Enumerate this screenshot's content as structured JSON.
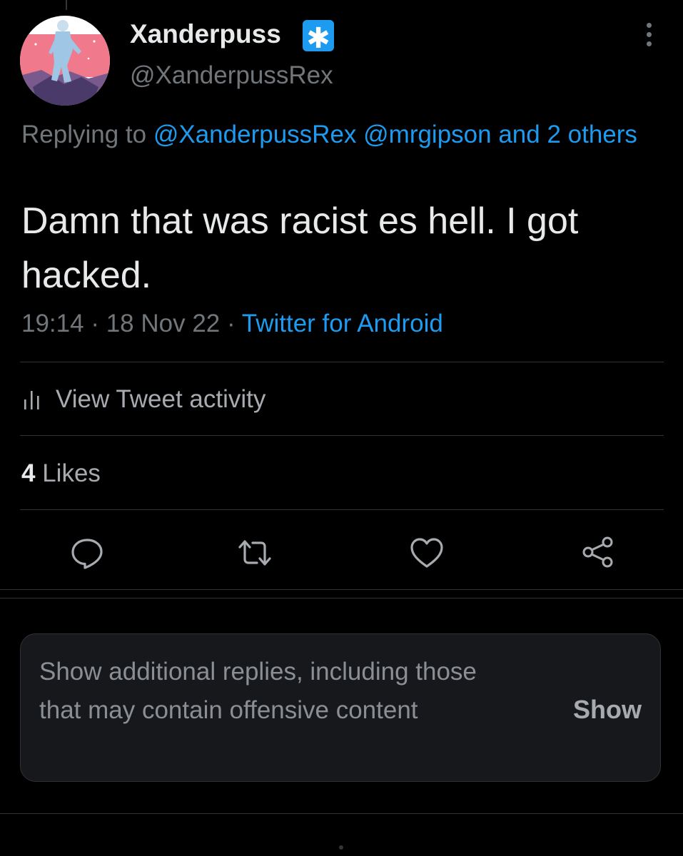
{
  "tweet": {
    "display_name": "Xanderpuss",
    "handle": "@XanderpussRex",
    "label_glyph": "✱",
    "replying_prefix": "Replying to",
    "replying_mentions": "@XanderpussRex @mrgipson and 2 others",
    "text": "Damn that was racist es hell. I got hacked.",
    "time": "19:14",
    "date": "18 Nov 22",
    "source": "Twitter for Android",
    "separator": "·"
  },
  "activity": {
    "label": "View Tweet activity",
    "icon": "bar-chart-icon"
  },
  "likes": {
    "count": "4",
    "label": "Likes"
  },
  "actions": [
    {
      "name": "reply",
      "icon": "reply-bubble-icon"
    },
    {
      "name": "retweet",
      "icon": "retweet-arrows-icon"
    },
    {
      "name": "like",
      "icon": "heart-icon"
    },
    {
      "name": "share",
      "icon": "share-nodes-icon"
    }
  ],
  "additional_replies": {
    "text": "Show additional replies, including those that may contain offensive content",
    "button_label": "Show"
  },
  "colors": {
    "background": "#000000",
    "primary_text": "#e7e9ea",
    "secondary_text": "#71767b",
    "accent": "#1d9bf0",
    "divider": "#2f3336",
    "card_background": "#16181c"
  }
}
